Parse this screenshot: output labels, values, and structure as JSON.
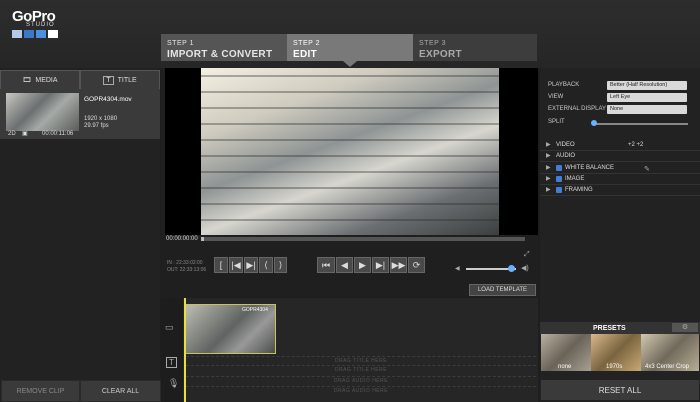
{
  "brand": {
    "logo": "GoPro",
    "sub": "STUDIO",
    "colors": [
      "#b7c9e8",
      "#3b78c9",
      "#4d8ee0",
      "#ffffff"
    ]
  },
  "steps": [
    {
      "num": "STEP 1",
      "title": "IMPORT & CONVERT"
    },
    {
      "num": "STEP 2",
      "title": "EDIT"
    },
    {
      "num": "STEP 3",
      "title": "EXPORT"
    }
  ],
  "left": {
    "media_label": "MEDIA",
    "title_label": "TITLE",
    "clip": {
      "name": "GOPR4304.mov",
      "resolution": "1920 x 1080",
      "fps": "29.97 fps",
      "mode": "2D",
      "duration": "00:00:11:06"
    },
    "remove_clip": "REMOVE CLIP",
    "clear_all": "CLEAR ALL"
  },
  "viewer": {
    "timecode": "00:00:00:00",
    "in": "IN : 22:33:02:00",
    "out": "OUT: 22:33:13:06",
    "volume": 0.85
  },
  "controls": [
    "⏮",
    "◀",
    "▶",
    "▶|",
    "▶▶",
    "⟳"
  ],
  "edit_controls": [
    "[",
    "|◀",
    "▶|",
    "⟨",
    "⟩"
  ],
  "load_template": "LOAD TEMPLATE",
  "timeline": {
    "clip_name": "GOPR4304",
    "drag_title_1": "DRAG TITLE HERE",
    "drag_title_2": "DRAG TITLE HERE",
    "drag_audio_1": "DRAG AUDIO HERE",
    "drag_audio_2": "DRAG AUDIO HERE"
  },
  "settings": {
    "playback_label": "PLAYBACK",
    "playback_value": "Better (Half Resolution)",
    "view_label": "VIEW",
    "view_value": "Left Eye",
    "external_label": "EXTERNAL DISPLAY",
    "external_value": "None",
    "split_label": "SPLIT"
  },
  "sections": [
    {
      "label": "VIDEO",
      "extra": "+2    +2"
    },
    {
      "label": "AUDIO",
      "extra": ""
    },
    {
      "label": "WHITE BALANCE",
      "extra": ""
    },
    {
      "label": "IMAGE",
      "extra": ""
    },
    {
      "label": "FRAMING",
      "extra": ""
    }
  ],
  "presets": {
    "title": "PRESETS",
    "items": [
      "none",
      "1970s",
      "4x3 Center Crop"
    ]
  },
  "reset_all": "RESET ALL"
}
